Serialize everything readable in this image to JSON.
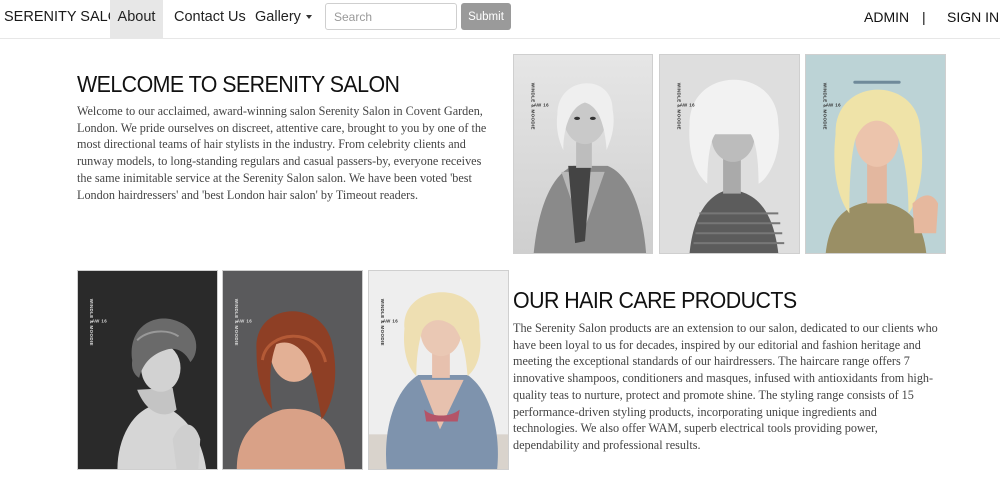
{
  "navbar": {
    "brand": "SERENITY SALON",
    "links": [
      "About",
      "Contact Us",
      "Gallery"
    ],
    "search": {
      "placeholder": "Search",
      "value": ""
    },
    "submit_label": "Submit",
    "admin_label": "ADMIN",
    "separator": "|",
    "signin_label": "SIGN IN",
    "icons": {
      "gallery_caret": "caret-down-icon"
    }
  },
  "welcome": {
    "title": "WELCOME TO SERENITY SALON",
    "body": "Welcome to our acclaimed, award-winning salon Serenity Salon in Covent Garden, London. We pride ourselves on discreet, attentive care, brought to you by one of the most directional teams of hair stylists in the industry. From celebrity clients and runway models, to long-standing regulars and casual passers-by, everyone receives the same inimitable service at the Serenity Salon salon. We have been voted 'best London hairdressers' and 'best London hair salon' by Timeout readers."
  },
  "products": {
    "title": "OUR HAIR CARE PRODUCTS",
    "body": "The Serenity Salon products are an extension to our salon, dedicated to our clients who have been loyal to us for decades, inspired by our editorial and fashion heritage and meeting the exceptional standards of our hairdressers. The haircare range offers 7 innovative shampoos, conditioners and masques, infused with antioxidants from high-quality teas to nurture, protect and promote shine. The styling range consists of 15 performance-driven styling products, incorporating unique ingredients and technologies. We also offer WAM, superb electrical tools providing power, dependability and professional results."
  },
  "gallery": {
    "watermark_brand": "WINDLE & MOODIE",
    "watermark_season": "AW 16"
  },
  "colors": {
    "nav_active_bg": "#e7e7e7",
    "submit_bg": "#9a9a9a",
    "heading": "#111111",
    "body_text": "#444444"
  }
}
